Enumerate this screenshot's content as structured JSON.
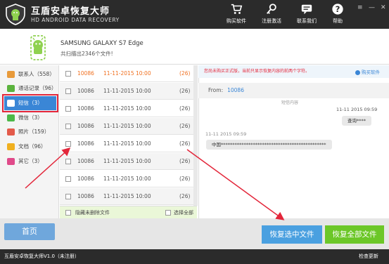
{
  "app": {
    "title": "互盾安卓恢复大师",
    "subtitle": "HD ANDROID DATA RECOVERY"
  },
  "toolbar": {
    "buy_label": "购买软件",
    "register_label": "注册激活",
    "contact_label": "联系我们",
    "help_label": "帮助"
  },
  "window_controls": {
    "menu": "≡",
    "minimize": "—",
    "close": "✕"
  },
  "device": {
    "name": "SAMSUNG  GALAXY S7 Edge",
    "scan_result": "共扫描出2346个文件!"
  },
  "sidebar": {
    "items": [
      {
        "label": "联系人（558）",
        "icon": "contacts-icon",
        "color": "#e89a3a"
      },
      {
        "label": "通话记录（96）",
        "icon": "phone-icon",
        "color": "#5bb33e"
      },
      {
        "label": "短信（3）",
        "icon": "sms-icon",
        "color": "#ffffff"
      },
      {
        "label": "微信（3）",
        "icon": "wechat-icon",
        "color": "#4cb848"
      },
      {
        "label": "照片（159）",
        "icon": "photo-icon",
        "color": "#e35a4a"
      },
      {
        "label": "文档（96）",
        "icon": "document-icon",
        "color": "#f0b020"
      },
      {
        "label": "其它（3）",
        "icon": "other-icon",
        "color": "#e04a8a"
      }
    ]
  },
  "messages": {
    "rows": [
      {
        "number": "10086",
        "date": "11-11-2015  10:00",
        "count": "(26)"
      },
      {
        "number": "10086",
        "date": "11-11-2015  10:00",
        "count": "(26)"
      },
      {
        "number": "10086",
        "date": "11-11-2015  10:00",
        "count": "(26)"
      },
      {
        "number": "10086",
        "date": "11-11-2015  10:00",
        "count": "(26)"
      },
      {
        "number": "10086",
        "date": "11-11-2015  10:00",
        "count": "(26)"
      },
      {
        "number": "10086",
        "date": "11-11-2015  10:00",
        "count": "(26)"
      },
      {
        "number": "10086",
        "date": "11-11-2015  10:00",
        "count": "(26)"
      },
      {
        "number": "10086",
        "date": "11-11-2015  10:00",
        "count": "(26)"
      }
    ],
    "hide_deleted_label": "隐藏未删除文件",
    "select_all_label": "选择全部"
  },
  "detail": {
    "notice": "您尚未购买正式版，当前只显示恢复内容的前两个字符。",
    "buy_link": "购买软件",
    "from_label": "From:",
    "from_value": "10086",
    "separator_label": "短信内容",
    "msg1_time": "11-11  2015  09:59",
    "msg1_text": "查询****",
    "msg2_time": "11-11  2015  09:59",
    "msg2_text": "中国**********************************************"
  },
  "footer": {
    "home_label": "首页",
    "recover_selected_label": "恢复选中文件",
    "recover_all_label": "恢复全部文件"
  },
  "status": {
    "version": "互盾安卓恢复大师V1.0（未注册）",
    "update_label": "检查更新"
  },
  "colors": {
    "accent": "#3a86d6",
    "highlight": "#e3263a",
    "green": "#6cc728"
  }
}
